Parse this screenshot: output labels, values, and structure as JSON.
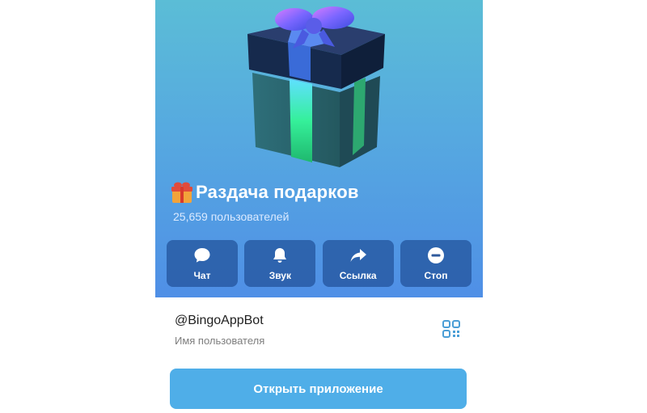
{
  "channel": {
    "title": "Раздача подарков",
    "title_emoji_icon": "wrapped-gift-emoji-icon",
    "subscribers": "25,659 пользователей",
    "art_icon": "gift-box-icon"
  },
  "actions": [
    {
      "label": "Чат",
      "icon": "chat-bubble-icon"
    },
    {
      "label": "Звук",
      "icon": "bell-icon"
    },
    {
      "label": "Ссылка",
      "icon": "share-arrow-icon"
    },
    {
      "label": "Стоп",
      "icon": "stop-circle-icon"
    }
  ],
  "info": {
    "username": "@BingoAppBot",
    "username_caption": "Имя пользователя",
    "qr_icon": "qr-code-icon"
  },
  "open_button": {
    "label": "Открыть приложение"
  },
  "colors": {
    "header_gradient_top": "#5bbdd6",
    "header_gradient_bottom": "#4f8fe6",
    "action_button_bg": "#1e4a8c",
    "open_button_bg": "#4faee8",
    "qr_icon": "#4a9ed6"
  }
}
